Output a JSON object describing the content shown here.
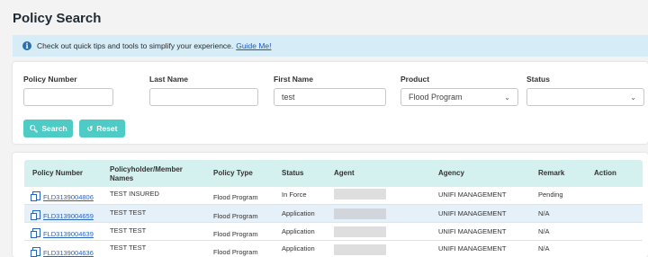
{
  "page": {
    "title": "Policy Search"
  },
  "info": {
    "icon": "info-circle-icon",
    "text": "Check out quick tips and tools to simplify your experience.",
    "link": "Guide Me!"
  },
  "search": {
    "fields": {
      "policy_number": {
        "label": "Policy Number",
        "value": ""
      },
      "last_name": {
        "label": "Last Name",
        "value": ""
      },
      "first_name": {
        "label": "First Name",
        "value": "test"
      },
      "product": {
        "label": "Product",
        "value": "Flood Program"
      },
      "status": {
        "label": "Status",
        "value": ""
      }
    },
    "search_button": "Search",
    "reset_button": "Reset"
  },
  "table": {
    "headers": {
      "policy_number": "Policy Number",
      "holder": "Policyholder/Member Names",
      "type": "Policy Type",
      "status": "Status",
      "agent": "Agent",
      "agency": "Agency",
      "remark": "Remark",
      "action": "Action"
    },
    "rows": [
      {
        "policy": "FLD3139004806",
        "holder": "TEST INSURED",
        "type": "Flood Program",
        "status": "In Force",
        "agency": "UNIFI MANAGEMENT",
        "remark": "Pending"
      },
      {
        "policy": "FLD3139004659",
        "holder": "TEST TEST",
        "type": "Flood Program",
        "status": "Application",
        "agency": "UNIFI MANAGEMENT",
        "remark": "N/A"
      },
      {
        "policy": "FLD3139004639",
        "holder": "TEST TEST",
        "type": "Flood Program",
        "status": "Application",
        "agency": "UNIFI MANAGEMENT",
        "remark": "N/A"
      },
      {
        "policy": "FLD3139004636",
        "holder": "TEST TEST",
        "type": "Flood Program",
        "status": "Application",
        "agency": "UNIFI MANAGEMENT",
        "remark": "N/A"
      }
    ]
  },
  "colors": {
    "accent": "#4dcbc4",
    "info_bg": "#d6ecf7",
    "header_bg": "#d4f1ef",
    "link": "#2a64b8"
  }
}
